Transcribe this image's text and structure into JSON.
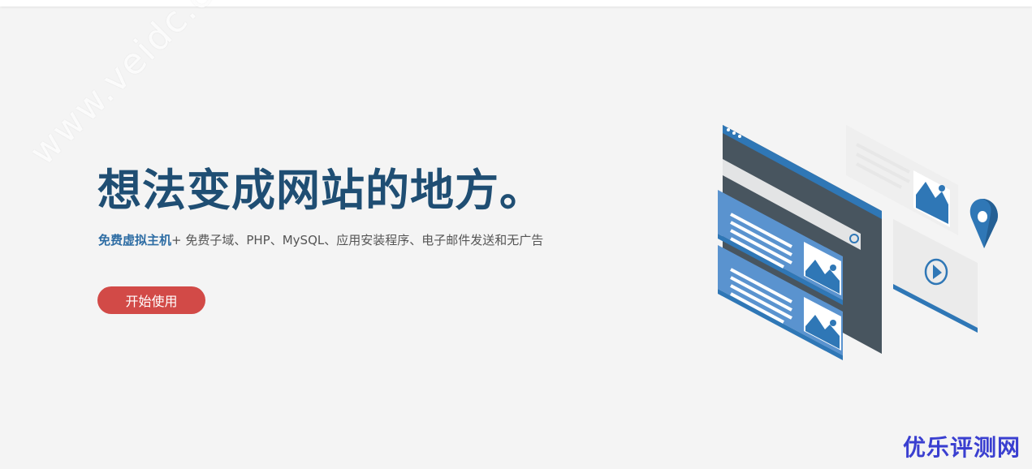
{
  "hero": {
    "title": "想法变成网站的地方。",
    "subtitle_highlight": "免费虚拟主机",
    "subtitle_rest": "+ 免费子域、PHP、MySQL、应用安装程序、电子邮件发送和无广告",
    "cta_label": "开始使用"
  },
  "watermark": {
    "diagonal_text": "www.veidc.com",
    "brand": "优乐评测网"
  },
  "colors": {
    "background": "#f4f4f4",
    "title": "#1f4e73",
    "highlight": "#2e6da4",
    "button": "#d24a47",
    "brand": "#3a3fd0"
  },
  "illustration": {
    "icons": [
      "browser-window-icon",
      "image-icon",
      "play-icon",
      "map-pin-icon"
    ]
  }
}
